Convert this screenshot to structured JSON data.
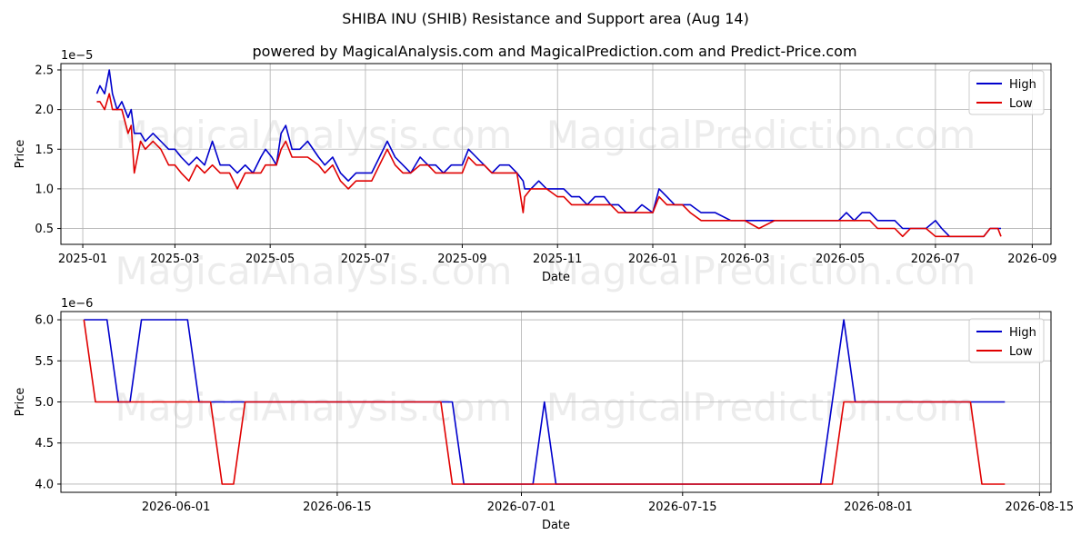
{
  "page": {
    "title": "SHIBA INU (SHIB) Resistance and Support area (Aug 14)",
    "subtitle": "powered by MagicalAnalysis.com and MagicalPrediction.com and Predict-Price.com",
    "watermarks": [
      "MagicalAnalysis.com",
      "MagicalPrediction.com"
    ]
  },
  "colors": {
    "high": "#0000cc",
    "low": "#e00000",
    "grid": "#b0b0b0"
  },
  "chart_data": [
    {
      "type": "line",
      "xlabel": "Date",
      "ylabel": "Price",
      "y_offset_label": "1e−5",
      "x_ticks": [
        "2025-01",
        "2025-03",
        "2025-05",
        "2025-07",
        "2025-09",
        "2025-11",
        "2026-01",
        "2026-03",
        "2026-05",
        "2026-07",
        "2026-09"
      ],
      "x_tick_dates": [
        "2025-01-01",
        "2025-03-01",
        "2025-05-01",
        "2025-07-01",
        "2025-09-01",
        "2025-11-01",
        "2026-01-01",
        "2026-03-01",
        "2026-05-01",
        "2026-07-01",
        "2026-09-01"
      ],
      "xlim": [
        "2024-12-18",
        "2026-09-13"
      ],
      "ylim": [
        0.3,
        2.58
      ],
      "y_ticks": [
        0.5,
        1.0,
        1.5,
        2.0,
        2.5
      ],
      "y_tick_labels": [
        "0.5",
        "1.0",
        "1.5",
        "2.0",
        "2.5"
      ],
      "grid": true,
      "legend": "top-right",
      "series": [
        {
          "name": "High",
          "x": [
            "2025-01-10",
            "2025-01-12",
            "2025-01-15",
            "2025-01-18",
            "2025-01-20",
            "2025-01-23",
            "2025-01-26",
            "2025-01-30",
            "2025-02-01",
            "2025-02-03",
            "2025-02-07",
            "2025-02-10",
            "2025-02-15",
            "2025-02-20",
            "2025-02-25",
            "2025-03-01",
            "2025-03-05",
            "2025-03-10",
            "2025-03-15",
            "2025-03-20",
            "2025-03-25",
            "2025-03-30",
            "2025-04-05",
            "2025-04-10",
            "2025-04-15",
            "2025-04-20",
            "2025-04-25",
            "2025-04-28",
            "2025-05-02",
            "2025-05-05",
            "2025-05-08",
            "2025-05-11",
            "2025-05-15",
            "2025-05-20",
            "2025-05-25",
            "2025-06-01",
            "2025-06-05",
            "2025-06-10",
            "2025-06-15",
            "2025-06-20",
            "2025-06-25",
            "2025-07-01",
            "2025-07-05",
            "2025-07-10",
            "2025-07-15",
            "2025-07-20",
            "2025-07-25",
            "2025-07-30",
            "2025-08-05",
            "2025-08-10",
            "2025-08-15",
            "2025-08-20",
            "2025-08-25",
            "2025-09-01",
            "2025-09-05",
            "2025-09-10",
            "2025-09-15",
            "2025-09-20",
            "2025-09-25",
            "2025-10-01",
            "2025-10-06",
            "2025-10-10",
            "2025-10-11",
            "2025-10-15",
            "2025-10-20",
            "2025-10-25",
            "2025-11-01",
            "2025-11-05",
            "2025-11-10",
            "2025-11-15",
            "2025-11-20",
            "2025-11-25",
            "2025-12-01",
            "2025-12-05",
            "2025-12-10",
            "2025-12-15",
            "2025-12-20",
            "2025-12-25",
            "2026-01-01",
            "2026-01-05",
            "2026-01-10",
            "2026-01-15",
            "2026-01-20",
            "2026-01-25",
            "2026-02-01",
            "2026-02-10",
            "2026-02-20",
            "2026-03-01",
            "2026-03-10",
            "2026-03-20",
            "2026-04-01",
            "2026-04-15",
            "2026-04-30",
            "2026-05-05",
            "2026-05-10",
            "2026-05-15",
            "2026-05-20",
            "2026-05-25",
            "2026-05-27",
            "2026-05-29",
            "2026-06-01",
            "2026-06-05",
            "2026-06-10",
            "2026-06-15",
            "2026-06-20",
            "2026-06-25",
            "2026-07-01",
            "2026-07-05",
            "2026-07-10",
            "2026-07-15",
            "2026-07-20",
            "2026-07-25",
            "2026-08-01",
            "2026-08-05",
            "2026-08-10",
            "2026-08-12"
          ],
          "values": [
            2.2,
            2.3,
            2.2,
            2.5,
            2.2,
            2.0,
            2.1,
            1.9,
            2.0,
            1.7,
            1.7,
            1.6,
            1.7,
            1.6,
            1.5,
            1.5,
            1.4,
            1.3,
            1.4,
            1.3,
            1.6,
            1.3,
            1.3,
            1.2,
            1.3,
            1.2,
            1.4,
            1.5,
            1.4,
            1.3,
            1.7,
            1.8,
            1.5,
            1.5,
            1.6,
            1.4,
            1.3,
            1.4,
            1.2,
            1.1,
            1.2,
            1.2,
            1.2,
            1.4,
            1.6,
            1.4,
            1.3,
            1.2,
            1.4,
            1.3,
            1.3,
            1.2,
            1.3,
            1.3,
            1.5,
            1.4,
            1.3,
            1.2,
            1.3,
            1.3,
            1.2,
            1.1,
            1.0,
            1.0,
            1.1,
            1.0,
            1.0,
            1.0,
            0.9,
            0.9,
            0.8,
            0.9,
            0.9,
            0.8,
            0.8,
            0.7,
            0.7,
            0.8,
            0.7,
            1.0,
            0.9,
            0.8,
            0.8,
            0.8,
            0.7,
            0.7,
            0.6,
            0.6,
            0.6,
            0.6,
            0.6,
            0.6,
            0.6,
            0.7,
            0.6,
            0.7,
            0.7,
            0.6,
            0.6,
            0.6,
            0.6,
            0.6,
            0.5,
            0.5,
            0.5,
            0.5,
            0.6,
            0.5,
            0.4,
            0.4,
            0.4,
            0.4,
            0.4,
            0.5,
            0.5,
            0.5
          ]
        },
        {
          "name": "Low",
          "x": [
            "2025-01-10",
            "2025-01-12",
            "2025-01-15",
            "2025-01-18",
            "2025-01-20",
            "2025-01-23",
            "2025-01-26",
            "2025-01-30",
            "2025-02-01",
            "2025-02-03",
            "2025-02-07",
            "2025-02-10",
            "2025-02-15",
            "2025-02-20",
            "2025-02-25",
            "2025-03-01",
            "2025-03-05",
            "2025-03-10",
            "2025-03-15",
            "2025-03-20",
            "2025-03-25",
            "2025-03-30",
            "2025-04-05",
            "2025-04-10",
            "2025-04-15",
            "2025-04-20",
            "2025-04-25",
            "2025-04-28",
            "2025-05-02",
            "2025-05-05",
            "2025-05-08",
            "2025-05-11",
            "2025-05-15",
            "2025-05-20",
            "2025-05-25",
            "2025-06-01",
            "2025-06-05",
            "2025-06-10",
            "2025-06-15",
            "2025-06-20",
            "2025-06-25",
            "2025-07-01",
            "2025-07-05",
            "2025-07-10",
            "2025-07-15",
            "2025-07-20",
            "2025-07-25",
            "2025-07-30",
            "2025-08-05",
            "2025-08-10",
            "2025-08-15",
            "2025-08-20",
            "2025-08-25",
            "2025-09-01",
            "2025-09-05",
            "2025-09-10",
            "2025-09-15",
            "2025-09-20",
            "2025-09-25",
            "2025-10-01",
            "2025-10-06",
            "2025-10-10",
            "2025-10-11",
            "2025-10-15",
            "2025-10-20",
            "2025-10-25",
            "2025-11-01",
            "2025-11-05",
            "2025-11-10",
            "2025-11-15",
            "2025-11-20",
            "2025-11-25",
            "2025-12-01",
            "2025-12-05",
            "2025-12-10",
            "2025-12-15",
            "2025-12-20",
            "2025-12-25",
            "2026-01-01",
            "2026-01-05",
            "2026-01-10",
            "2026-01-15",
            "2026-01-20",
            "2026-01-25",
            "2026-02-01",
            "2026-02-10",
            "2026-02-20",
            "2026-03-01",
            "2026-03-10",
            "2026-03-20",
            "2026-04-01",
            "2026-04-15",
            "2026-04-30",
            "2026-05-05",
            "2026-05-10",
            "2026-05-15",
            "2026-05-20",
            "2026-05-25",
            "2026-05-27",
            "2026-05-29",
            "2026-06-01",
            "2026-06-05",
            "2026-06-10",
            "2026-06-15",
            "2026-06-20",
            "2026-06-25",
            "2026-07-01",
            "2026-07-05",
            "2026-07-10",
            "2026-07-15",
            "2026-07-20",
            "2026-07-25",
            "2026-08-01",
            "2026-08-05",
            "2026-08-10",
            "2026-08-12"
          ],
          "values": [
            2.1,
            2.1,
            2.0,
            2.2,
            2.0,
            2.0,
            2.0,
            1.7,
            1.8,
            1.2,
            1.6,
            1.5,
            1.6,
            1.5,
            1.3,
            1.3,
            1.2,
            1.1,
            1.3,
            1.2,
            1.3,
            1.2,
            1.2,
            1.0,
            1.2,
            1.2,
            1.2,
            1.3,
            1.3,
            1.3,
            1.5,
            1.6,
            1.4,
            1.4,
            1.4,
            1.3,
            1.2,
            1.3,
            1.1,
            1.0,
            1.1,
            1.1,
            1.1,
            1.3,
            1.5,
            1.3,
            1.2,
            1.2,
            1.3,
            1.3,
            1.2,
            1.2,
            1.2,
            1.2,
            1.4,
            1.3,
            1.3,
            1.2,
            1.2,
            1.2,
            1.2,
            0.7,
            0.9,
            1.0,
            1.0,
            1.0,
            0.9,
            0.9,
            0.8,
            0.8,
            0.8,
            0.8,
            0.8,
            0.8,
            0.7,
            0.7,
            0.7,
            0.7,
            0.7,
            0.9,
            0.8,
            0.8,
            0.8,
            0.7,
            0.6,
            0.6,
            0.6,
            0.6,
            0.5,
            0.6,
            0.6,
            0.6,
            0.6,
            0.6,
            0.6,
            0.6,
            0.6,
            0.5,
            0.5,
            0.5,
            0.5,
            0.5,
            0.4,
            0.5,
            0.5,
            0.5,
            0.4,
            0.4,
            0.4,
            0.4,
            0.4,
            0.4,
            0.4,
            0.5,
            0.5,
            0.4
          ]
        }
      ]
    },
    {
      "type": "line",
      "xlabel": "Date",
      "ylabel": "Price",
      "y_offset_label": "1e−6",
      "x_ticks": [
        "2026-06-01",
        "2026-06-15",
        "2026-07-01",
        "2026-07-15",
        "2026-08-01",
        "2026-08-15"
      ],
      "x_tick_dates": [
        "2026-06-01",
        "2026-06-15",
        "2026-07-01",
        "2026-07-15",
        "2026-08-01",
        "2026-08-15"
      ],
      "xlim": [
        "2026-05-22",
        "2026-08-16"
      ],
      "ylim": [
        3.9,
        6.1
      ],
      "y_ticks": [
        4.0,
        4.5,
        5.0,
        5.5,
        6.0
      ],
      "y_tick_labels": [
        "4.0",
        "4.5",
        "5.0",
        "5.5",
        "6.0"
      ],
      "grid": true,
      "legend": "top-right",
      "series": [
        {
          "name": "High",
          "x": [
            "2026-05-24",
            "2026-05-26",
            "2026-05-27",
            "2026-05-28",
            "2026-05-29",
            "2026-05-30",
            "2026-05-31",
            "2026-06-01",
            "2026-06-02",
            "2026-06-03",
            "2026-06-04",
            "2026-06-05",
            "2026-06-06",
            "2026-06-07",
            "2026-06-08",
            "2026-06-09",
            "2026-06-10",
            "2026-06-11",
            "2026-06-12",
            "2026-06-13",
            "2026-06-14",
            "2026-06-15",
            "2026-06-16",
            "2026-06-17",
            "2026-06-18",
            "2026-06-19",
            "2026-06-20",
            "2026-06-21",
            "2026-06-22",
            "2026-06-23",
            "2026-06-24",
            "2026-06-25",
            "2026-06-26",
            "2026-06-27",
            "2026-06-28",
            "2026-06-29",
            "2026-06-30",
            "2026-07-01",
            "2026-07-02",
            "2026-07-03",
            "2026-07-04",
            "2026-07-05",
            "2026-07-06",
            "2026-07-07",
            "2026-07-08",
            "2026-07-09",
            "2026-07-10",
            "2026-07-11",
            "2026-07-12",
            "2026-07-13",
            "2026-07-14",
            "2026-07-15",
            "2026-07-16",
            "2026-07-17",
            "2026-07-18",
            "2026-07-19",
            "2026-07-20",
            "2026-07-21",
            "2026-07-22",
            "2026-07-23",
            "2026-07-24",
            "2026-07-25",
            "2026-07-26",
            "2026-07-27",
            "2026-07-28",
            "2026-07-29",
            "2026-07-30",
            "2026-07-31",
            "2026-08-01",
            "2026-08-02",
            "2026-08-03",
            "2026-08-04",
            "2026-08-05",
            "2026-08-06",
            "2026-08-07",
            "2026-08-08",
            "2026-08-09",
            "2026-08-10",
            "2026-08-11",
            "2026-08-12"
          ],
          "values": [
            6.0,
            6.0,
            5.0,
            5.0,
            6.0,
            6.0,
            6.0,
            6.0,
            6.0,
            5.0,
            5.0,
            5.0,
            5.0,
            5.0,
            5.0,
            5.0,
            5.0,
            5.0,
            5.0,
            5.0,
            5.0,
            5.0,
            5.0,
            5.0,
            5.0,
            5.0,
            5.0,
            5.0,
            5.0,
            5.0,
            5.0,
            5.0,
            4.0,
            4.0,
            4.0,
            4.0,
            4.0,
            4.0,
            4.0,
            5.0,
            4.0,
            4.0,
            4.0,
            4.0,
            4.0,
            4.0,
            4.0,
            4.0,
            4.0,
            4.0,
            4.0,
            4.0,
            4.0,
            4.0,
            4.0,
            4.0,
            4.0,
            4.0,
            4.0,
            4.0,
            4.0,
            4.0,
            4.0,
            4.0,
            5.0,
            6.0,
            5.0,
            5.0,
            5.0,
            5.0,
            5.0,
            5.0,
            5.0,
            5.0,
            5.0,
            5.0,
            5.0,
            5.0,
            5.0,
            5.0
          ],
          "values_exact": null
        },
        {
          "name": "Low",
          "x": [
            "2026-05-24",
            "2026-05-25",
            "2026-06-04",
            "2026-06-05",
            "2026-06-06",
            "2026-06-07",
            "2026-06-24",
            "2026-06-25",
            "2026-07-28",
            "2026-07-29",
            "2026-08-09",
            "2026-08-10",
            "2026-08-12"
          ],
          "values": [
            6.0,
            5.0,
            5.0,
            4.0,
            4.0,
            5.0,
            5.0,
            4.0,
            4.0,
            5.0,
            5.0,
            4.0,
            4.0
          ]
        }
      ]
    }
  ]
}
